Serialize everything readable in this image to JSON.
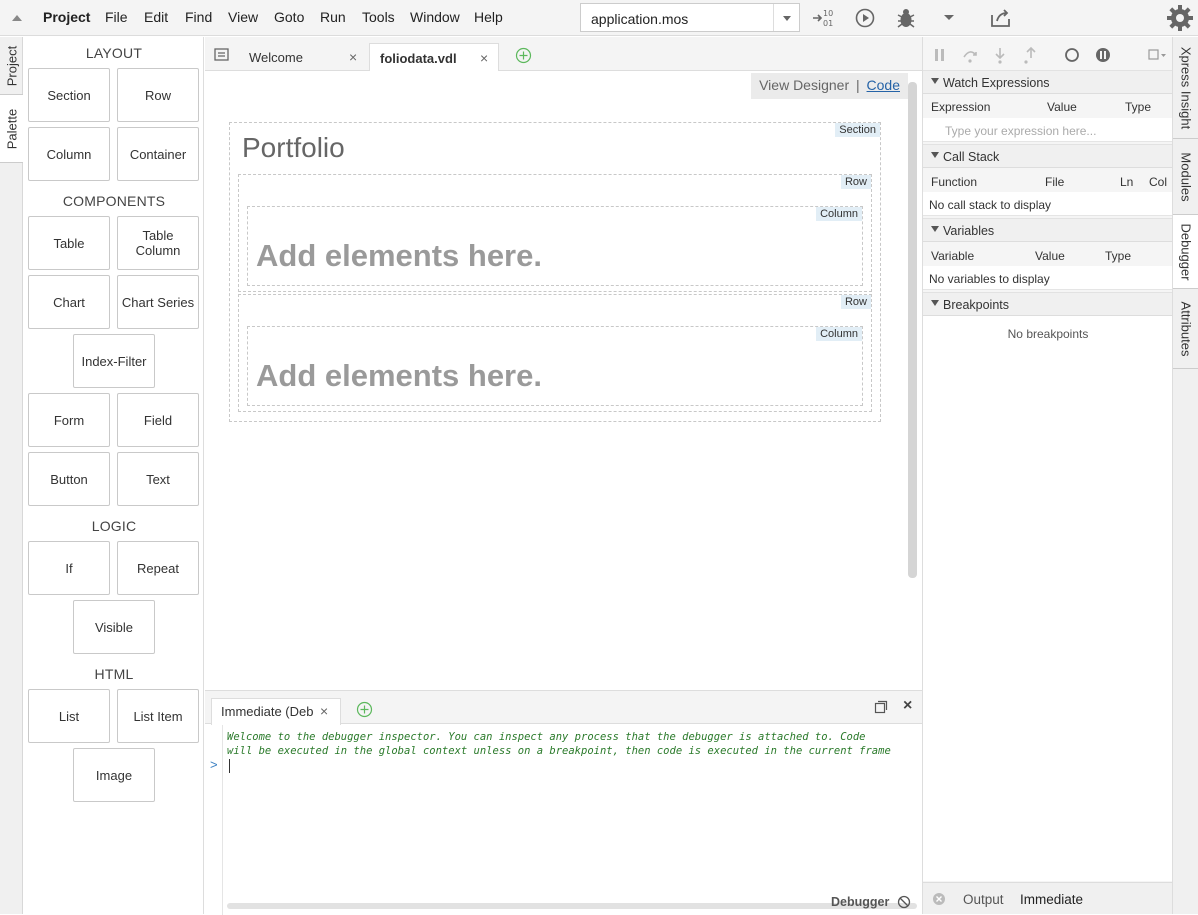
{
  "menu": {
    "project": "Project",
    "items": [
      "File",
      "Edit",
      "Find",
      "View",
      "Goto",
      "Run",
      "Tools",
      "Window",
      "Help"
    ]
  },
  "toolbar": {
    "file_select": "application.mos",
    "icons": [
      "step-into-icon",
      "run-icon",
      "debug-icon",
      "chevron-down-icon",
      "export-icon",
      "gear-icon"
    ]
  },
  "left_tabs": {
    "project": "Project",
    "palette": "Palette"
  },
  "palette": {
    "layout_title": "LAYOUT",
    "components_title": "COMPONENTS",
    "logic_title": "LOGIC",
    "html_title": "HTML",
    "section": "Section",
    "row": "Row",
    "column": "Column",
    "container": "Container",
    "table": "Table",
    "table_column": "Table Column",
    "chart": "Chart",
    "chart_series": "Chart Series",
    "index_filter": "Index-Filter",
    "form": "Form",
    "field": "Field",
    "button": "Button",
    "text": "Text",
    "if": "If",
    "repeat": "Repeat",
    "visible": "Visible",
    "list": "List",
    "list_item": "List Item",
    "image": "Image"
  },
  "editor": {
    "tab_welcome": "Welcome",
    "tab_active": "foliodata.vdl",
    "view_designer": "View Designer",
    "separator": "|",
    "code": "Code",
    "section_tag": "Section",
    "title": "Portfolio",
    "row_tag": "Row",
    "column_tag": "Column",
    "placeholder": "Add elements here."
  },
  "immediate": {
    "tab_label": "Immediate (Deb",
    "line1": "Welcome to the debugger inspector. You can inspect any process that the debugger is attached to. Code",
    "line2": "will be executed in the global context unless on a breakpoint, then code is executed in the current frame",
    "prompt": ">",
    "debugger_label": "Debugger"
  },
  "debug_panel": {
    "watch_title": "Watch Expressions",
    "watch_cols": [
      "Expression",
      "Value",
      "Type"
    ],
    "watch_placeholder": "Type your expression here...",
    "callstack_title": "Call Stack",
    "callstack_cols": [
      "Function",
      "File",
      "Ln",
      "Col"
    ],
    "callstack_empty": "No call stack to display",
    "variables_title": "Variables",
    "variables_cols": [
      "Variable",
      "Value",
      "Type"
    ],
    "variables_empty": "No variables to display",
    "breakpoints_title": "Breakpoints",
    "breakpoints_empty": "No breakpoints",
    "bottom_tabs": [
      "Output",
      "Immediate"
    ]
  },
  "right_tabs": [
    "Xpress Insight",
    "Modules",
    "Debugger",
    "Attributes"
  ],
  "colors": {
    "accent_green": "#5cb85c",
    "link": "#2563a7",
    "tag_bg": "#e2eef6"
  }
}
